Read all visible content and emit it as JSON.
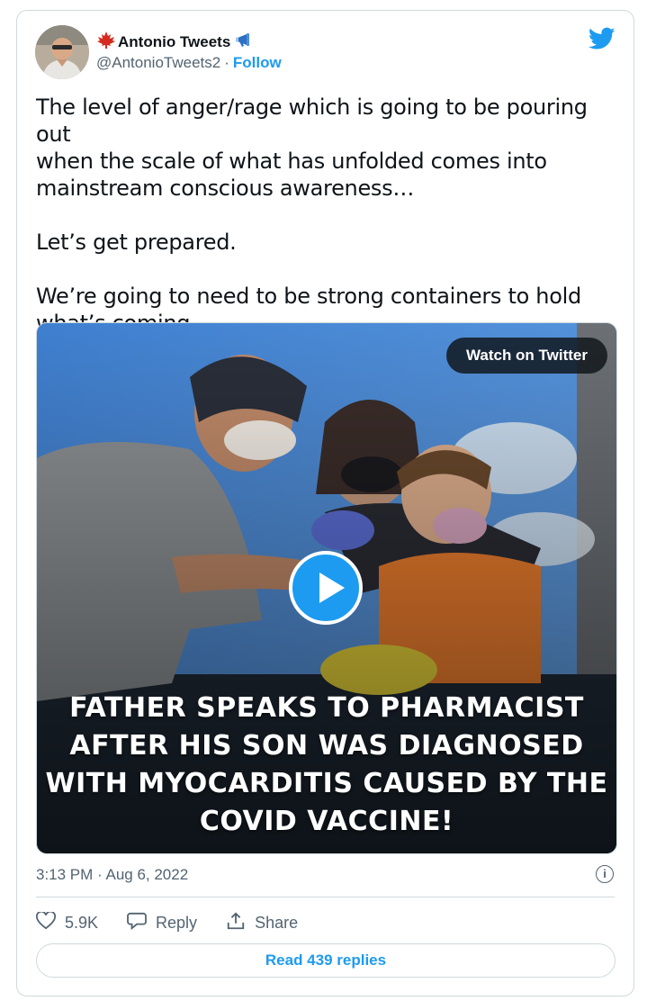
{
  "author": {
    "display_name": "Antonio Tweets",
    "handle": "@AntonioTweets2",
    "separator": "·",
    "follow_label": "Follow",
    "flag_icon": "maple-leaf-icon",
    "badge_icon": "megaphone-icon"
  },
  "tweet": {
    "paragraphs": [
      "The level of anger/rage which is going to be pouring out\nwhen the scale of what has unfolded comes into\nmainstream conscious awareness…",
      "Let’s get prepared.",
      "We’re going to need to be strong containers to hold\nwhat’s coming."
    ]
  },
  "media": {
    "watch_label": "Watch on Twitter",
    "caption_lines": [
      "FATHER SPEAKS TO PHARMACIST",
      "AFTER HIS SON WAS DIAGNOSED",
      "WITH MYOCARDITIS CAUSED BY THE",
      "COVID VACCINE!"
    ]
  },
  "meta": {
    "timestamp": "3:13 PM · Aug 6, 2022",
    "info_glyph": "i"
  },
  "actions": {
    "like_count": "5.9K",
    "reply_label": "Reply",
    "share_label": "Share"
  },
  "footer": {
    "read_replies_label": "Read 439 replies"
  },
  "colors": {
    "accent": "#1d9bf0",
    "text": "#0f1419",
    "muted": "#536471",
    "border": "#cfd9de"
  }
}
